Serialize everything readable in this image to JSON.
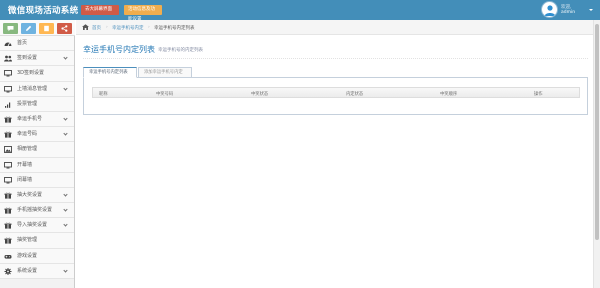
{
  "app": {
    "title": "微信现场活动系统",
    "header_buttons": [
      "去大屏幕界面",
      "活动信息及功能设置"
    ],
    "user": {
      "welcome": "欢迎,",
      "name": "admin"
    }
  },
  "colors": {
    "navbar": "#438eb9",
    "accent": "#2679b5",
    "btn_red": "#d15b47",
    "btn_orange": "#f0ad4e"
  },
  "shortcuts": [
    {
      "icon": "comment-icon",
      "color": "#87b87f"
    },
    {
      "icon": "pencil-icon",
      "color": "#6fb3e0"
    },
    {
      "icon": "users-icon",
      "color": "#ffb752"
    },
    {
      "icon": "share-icon",
      "color": "#d15b47"
    }
  ],
  "sidebar": {
    "items": [
      {
        "label": "首页",
        "icon": "tachometer-icon",
        "has_submenu": false
      },
      {
        "label": "签到设置",
        "icon": "users-icon",
        "has_submenu": true
      },
      {
        "label": "3D签到设置",
        "icon": "monitor-icon",
        "has_submenu": false
      },
      {
        "label": "上墙消息管理",
        "icon": "monitor-icon",
        "has_submenu": true
      },
      {
        "label": "投票管理",
        "icon": "bar-chart-icon",
        "has_submenu": false
      },
      {
        "label": "幸运手机号",
        "icon": "gift-icon",
        "has_submenu": true
      },
      {
        "label": "幸运号码",
        "icon": "gift-icon",
        "has_submenu": true
      },
      {
        "label": "相册管理",
        "icon": "picture-icon",
        "has_submenu": false
      },
      {
        "label": "开幕墙",
        "icon": "monitor-icon",
        "has_submenu": false
      },
      {
        "label": "闭幕墙",
        "icon": "monitor-icon",
        "has_submenu": false
      },
      {
        "label": "抽大奖设置",
        "icon": "gift-icon",
        "has_submenu": true
      },
      {
        "label": "手机摇抽奖设置",
        "icon": "gift-icon",
        "has_submenu": true
      },
      {
        "label": "导入抽奖设置",
        "icon": "gift-icon",
        "has_submenu": true
      },
      {
        "label": "抽奖管理",
        "icon": "gift-icon",
        "has_submenu": false
      },
      {
        "label": "游戏设置",
        "icon": "gamepad-icon",
        "has_submenu": false
      },
      {
        "label": "系统设置",
        "icon": "gear-icon",
        "has_submenu": true
      }
    ]
  },
  "breadcrumb": {
    "home": "首页",
    "parent": "幸运手机号内定",
    "current": "幸运手机号内定列表"
  },
  "page": {
    "title": "幸运手机号内定列表",
    "subtitle": "幸运手机号的内定列表"
  },
  "tabs": [
    "幸运手机号内定列表",
    "添加幸运手机号内定"
  ],
  "table": {
    "headers": [
      "昵称",
      "中奖号码",
      "中奖状态",
      "内定状态",
      "中奖顺序",
      "操作"
    ]
  }
}
